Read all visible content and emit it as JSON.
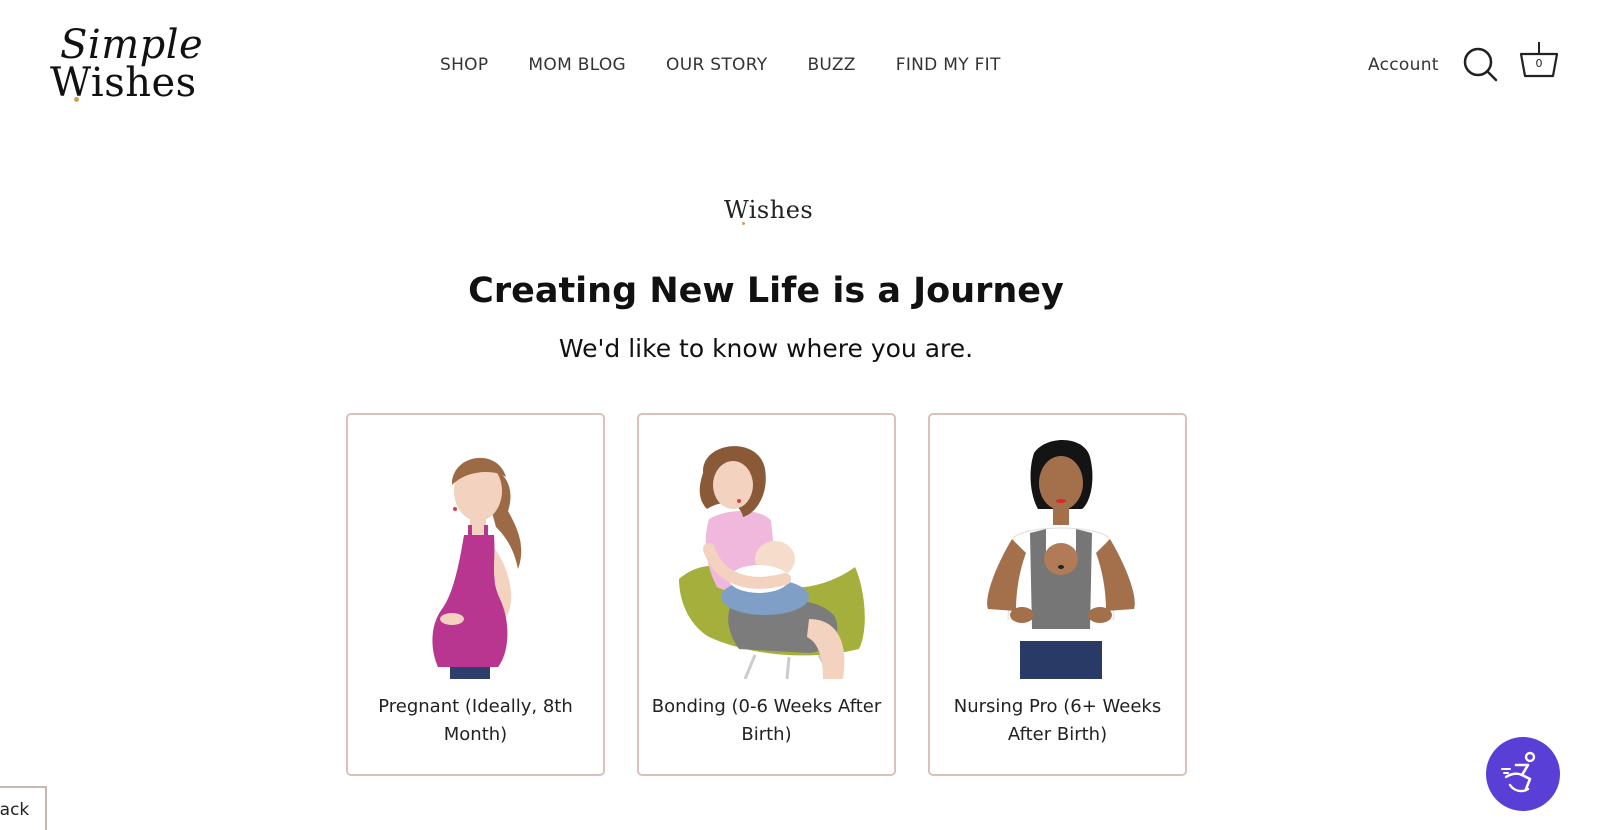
{
  "brand": {
    "logo_line1": "Simple",
    "logo_line2": "Wishes",
    "mini_logo": "Wishes",
    "accent_color": "#c9a15c"
  },
  "nav": {
    "items": [
      "SHOP",
      "MOM BLOG",
      "OUR STORY",
      "BUZZ",
      "FIND MY FIT"
    ]
  },
  "header_actions": {
    "account_label": "Account",
    "search_icon": "search-icon",
    "cart_icon": "basket-icon",
    "cart_count": "0"
  },
  "main": {
    "title": "Creating New Life is a Journey",
    "subtitle": "We'd like to know where you are.",
    "options": [
      {
        "label": "Pregnant (Ideally, 8th Month)",
        "illustration": "pregnant-woman-illustration"
      },
      {
        "label": "Bonding (0-6 Weeks After Birth)",
        "illustration": "nursing-mother-in-chair-illustration"
      },
      {
        "label": "Nursing Pro (6+ Weeks After Birth)",
        "illustration": "mother-with-baby-carrier-illustration"
      }
    ],
    "card_border_color": "#d9c2bc"
  },
  "floating": {
    "back_label": "Back",
    "accessibility_icon": "accessibility-icon",
    "accessibility_color": "#5a3fd6"
  }
}
